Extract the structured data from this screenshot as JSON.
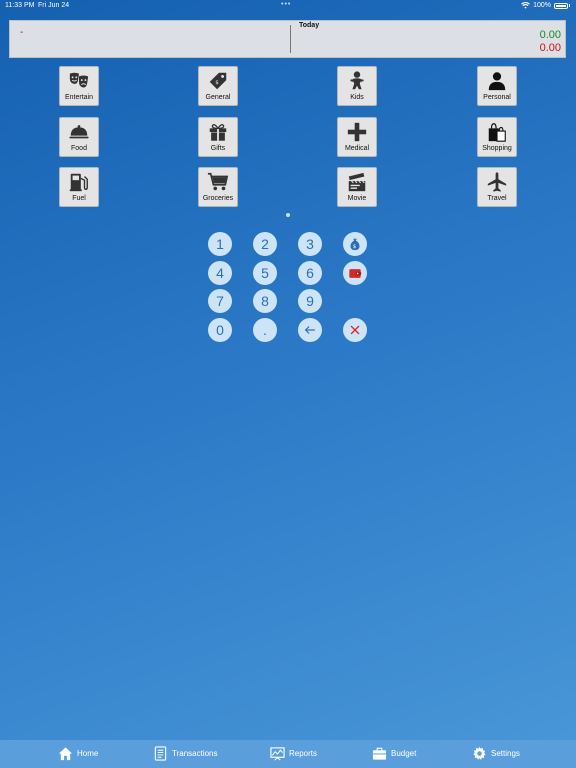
{
  "status_bar": {
    "time": "11:33 PM",
    "date": "Fri Jun 24",
    "battery": "100%"
  },
  "summary": {
    "period_label": "Today",
    "entry_marker": "-",
    "value_income": "0.00",
    "value_expense": "0.00"
  },
  "categories": [
    {
      "label": "Entertain",
      "icon": "theater-masks-icon"
    },
    {
      "label": "General",
      "icon": "price-tag-icon"
    },
    {
      "label": "Kids",
      "icon": "baby-icon"
    },
    {
      "label": "Personal",
      "icon": "person-icon"
    },
    {
      "label": "Food",
      "icon": "food-cloche-icon"
    },
    {
      "label": "Gifts",
      "icon": "gift-icon"
    },
    {
      "label": "Medical",
      "icon": "medical-cross-icon"
    },
    {
      "label": "Shopping",
      "icon": "shopping-bags-icon"
    },
    {
      "label": "Fuel",
      "icon": "fuel-pump-icon"
    },
    {
      "label": "Groceries",
      "icon": "shopping-cart-icon"
    },
    {
      "label": "Movie",
      "icon": "clapperboard-icon"
    },
    {
      "label": "Travel",
      "icon": "airplane-icon"
    }
  ],
  "keypad": {
    "keys": [
      "1",
      "2",
      "3",
      "4",
      "5",
      "6",
      "7",
      "8",
      "9",
      "0",
      "."
    ],
    "income_icon": "money-bag-icon",
    "expense_icon": "wallet-icon",
    "backspace_icon": "backspace-arrow-icon",
    "clear_icon": "clear-x-icon"
  },
  "tabs": [
    {
      "label": "Home",
      "icon": "home-icon"
    },
    {
      "label": "Transactions",
      "icon": "transactions-list-icon"
    },
    {
      "label": "Reports",
      "icon": "reports-chart-icon"
    },
    {
      "label": "Budget",
      "icon": "briefcase-icon"
    },
    {
      "label": "Settings",
      "icon": "gear-icon"
    }
  ],
  "colors": {
    "income_green": "#1a8a2a",
    "expense_red": "#d01010",
    "tab_bar": "#5a9fdc",
    "key_fill": "#cde4f7"
  }
}
